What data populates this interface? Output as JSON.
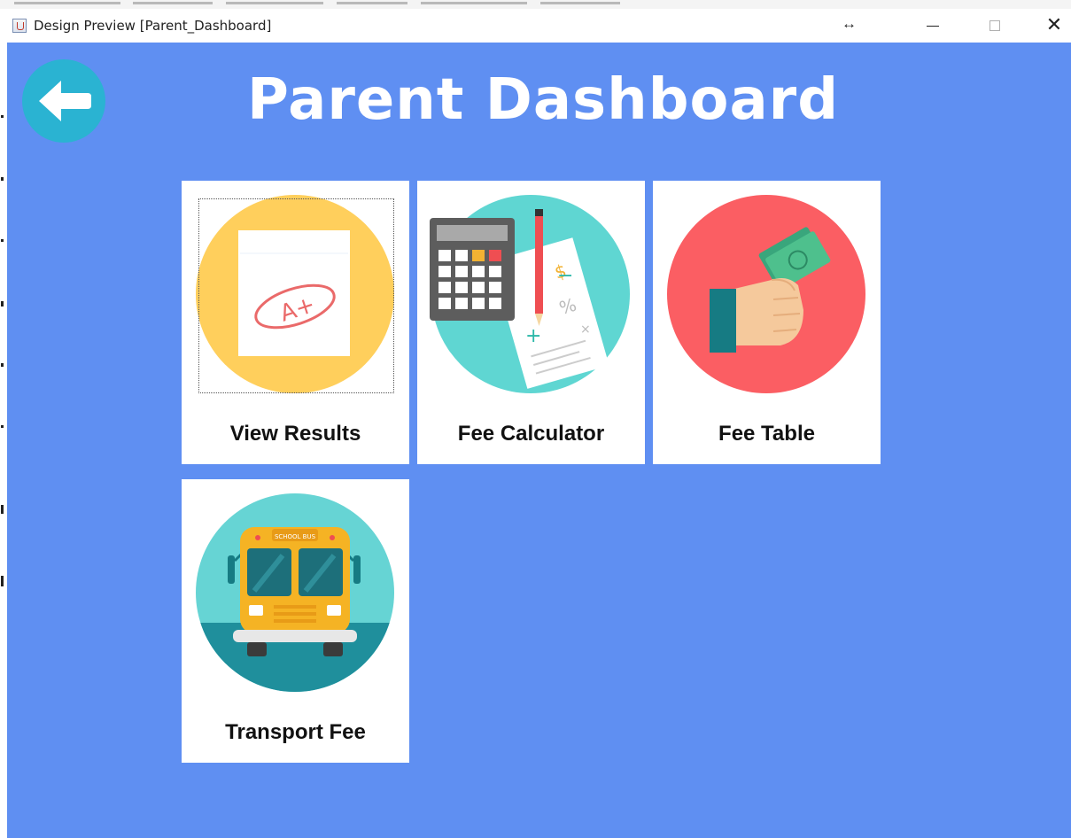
{
  "window": {
    "title": "Design Preview [Parent_Dashboard]",
    "resize_glyph": "↔",
    "close_glyph": "✕"
  },
  "header": {
    "title": "Parent Dashboard",
    "back_icon": "arrow-left-icon"
  },
  "tiles": [
    {
      "label": "View Results",
      "icon": "graded-paper-icon"
    },
    {
      "label": "Fee Calculator",
      "icon": "calculator-icon"
    },
    {
      "label": "Fee Table",
      "icon": "hand-money-icon"
    },
    {
      "label": "Transport Fee",
      "icon": "school-bus-icon"
    }
  ],
  "images": {
    "grade_text": "A+",
    "bus_sign": "SCHOOL BUS"
  },
  "colors": {
    "background": "#5f8ff2",
    "back_button": "#2ab3d2",
    "results_circle": "#ffcf5c",
    "calc_circle": "#5fd6d2",
    "table_circle": "#fb5e63",
    "bus_circle": "#66d4d4"
  }
}
